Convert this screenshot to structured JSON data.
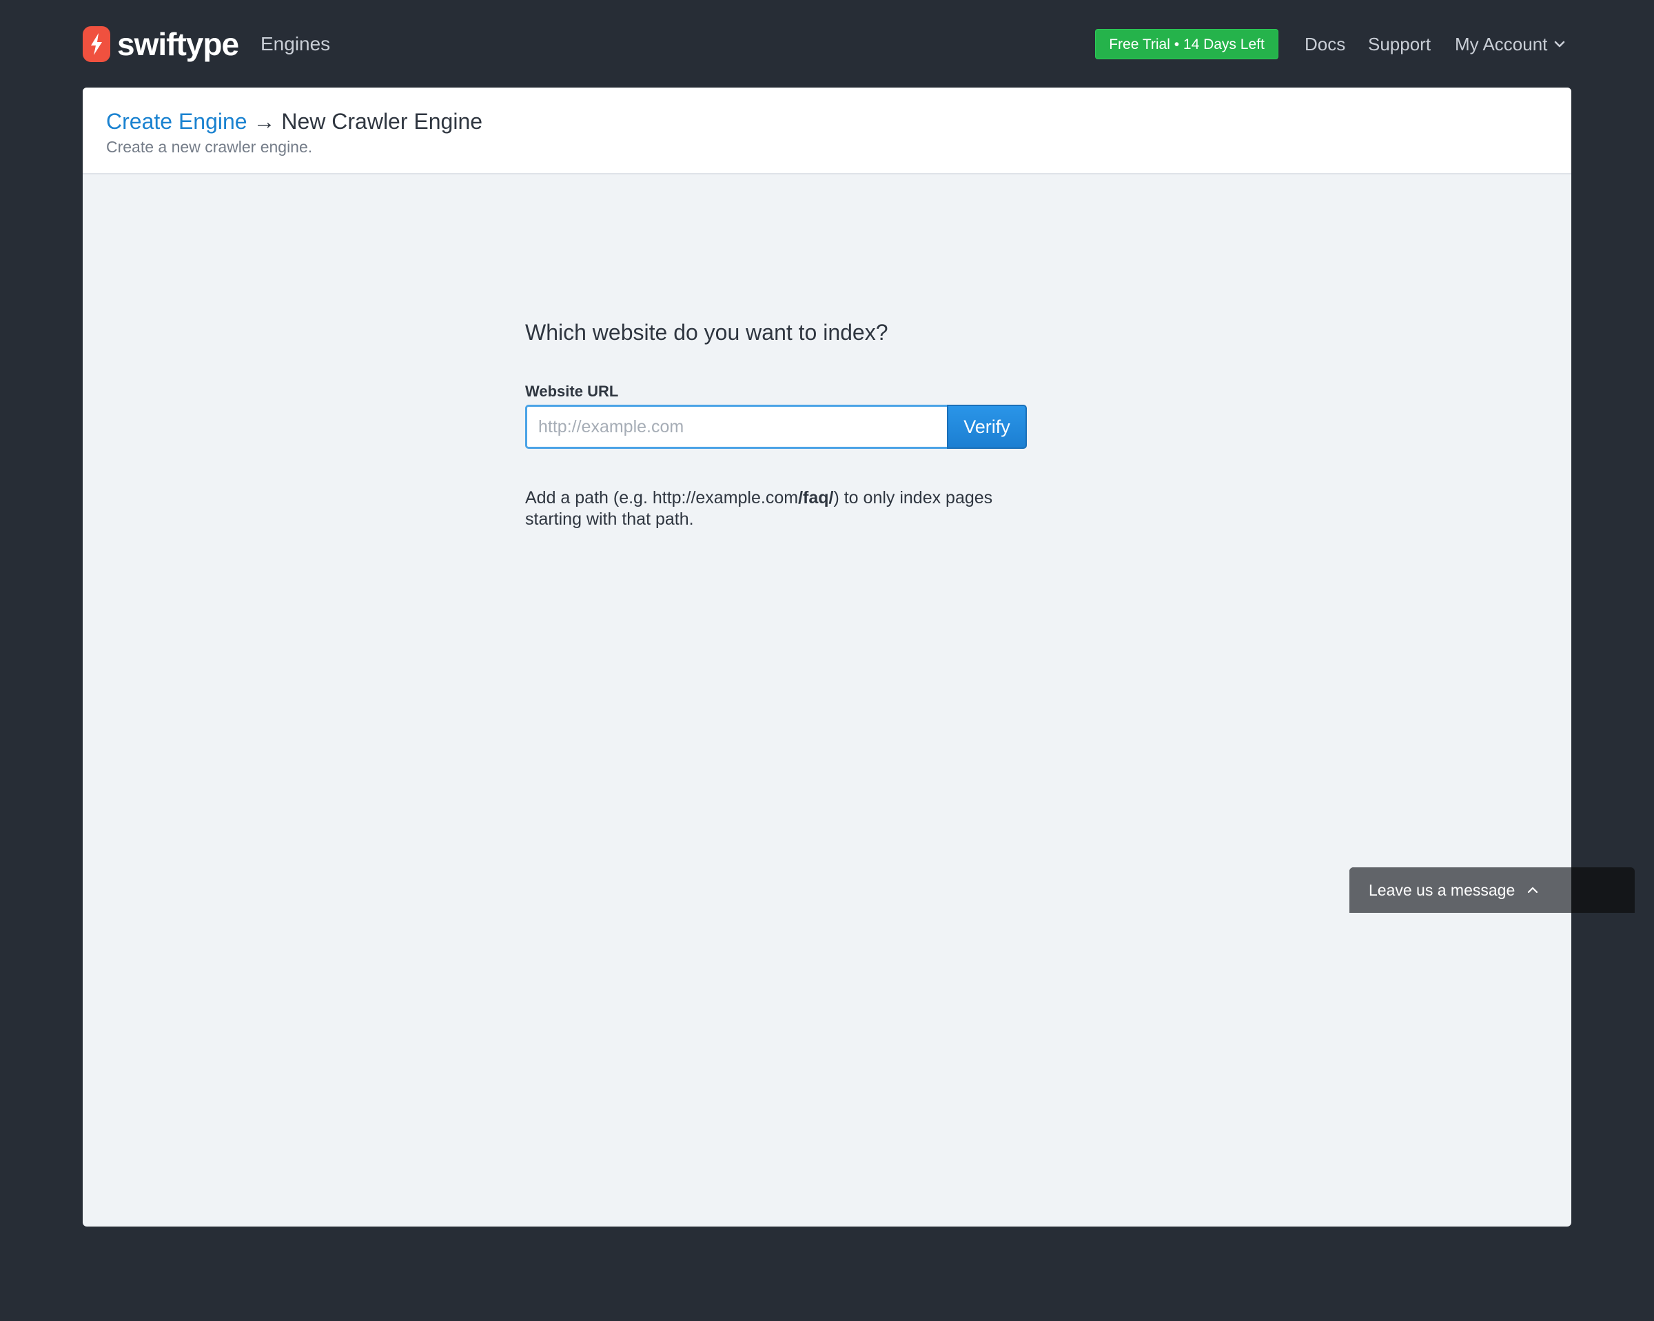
{
  "nav": {
    "brand": "swiftype",
    "engines": "Engines",
    "trial": "Free Trial • 14 Days Left",
    "docs": "Docs",
    "support": "Support",
    "account": "My Account"
  },
  "header": {
    "breadcrumb_link": "Create Engine",
    "arrow": "→",
    "current": "New Crawler Engine",
    "subtitle": "Create a new crawler engine."
  },
  "form": {
    "question": "Which website do you want to index?",
    "label": "Website URL",
    "placeholder": "http://example.com",
    "value": "",
    "verify": "Verify",
    "help_prefix": "Add a path (e.g. http://example.com",
    "help_bold": "/faq/",
    "help_suffix": ") to only index pages starting with that path."
  },
  "chat": {
    "label": "Leave us a message"
  },
  "colors": {
    "page_bg": "#272d36",
    "card_bg": "#f0f3f6",
    "link": "#1a82d0",
    "trial_green": "#25b34b",
    "brand_red": "#f0513f",
    "verify_blue": "#1c7fd2"
  },
  "icons": {
    "logo": "lightning-bolt-icon",
    "account_dropdown": "chevron-down-icon",
    "chat_expand": "chevron-up-icon"
  }
}
